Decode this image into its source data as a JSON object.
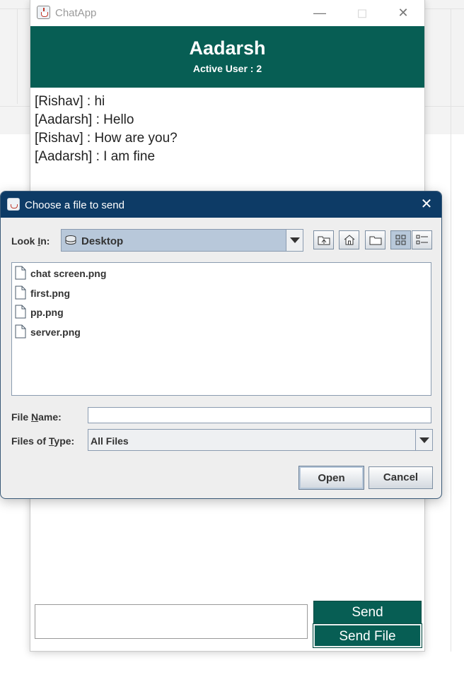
{
  "chat_window": {
    "title": "ChatApp",
    "user_name": "Aadarsh",
    "active_users": "Active User : 2",
    "messages": [
      "[Rishav] : hi",
      "[Aadarsh] : Hello",
      "[Rishav] : How are you?",
      "[Aadarsh] : I am fine"
    ],
    "message_input_value": "",
    "send_label": "Send",
    "send_file_label": "Send File",
    "header_color": "#075e54"
  },
  "file_dialog": {
    "title": "Choose a file to send",
    "look_in_label_pre": "Look ",
    "look_in_label_key": "I",
    "look_in_label_post": "n:",
    "look_in_value": "Desktop",
    "files": [
      "chat screen.png",
      "first.png",
      "pp.png",
      "server.png"
    ],
    "file_name_label_pre": "File ",
    "file_name_label_key": "N",
    "file_name_label_post": "ame:",
    "file_name_value": "",
    "files_of_type_label_pre": "Files of ",
    "files_of_type_label_key": "T",
    "files_of_type_label_post": "ype:",
    "files_of_type_value": "All Files",
    "open_label": "Open",
    "cancel_label": "Cancel",
    "titlebar_color": "#0d3b66"
  }
}
